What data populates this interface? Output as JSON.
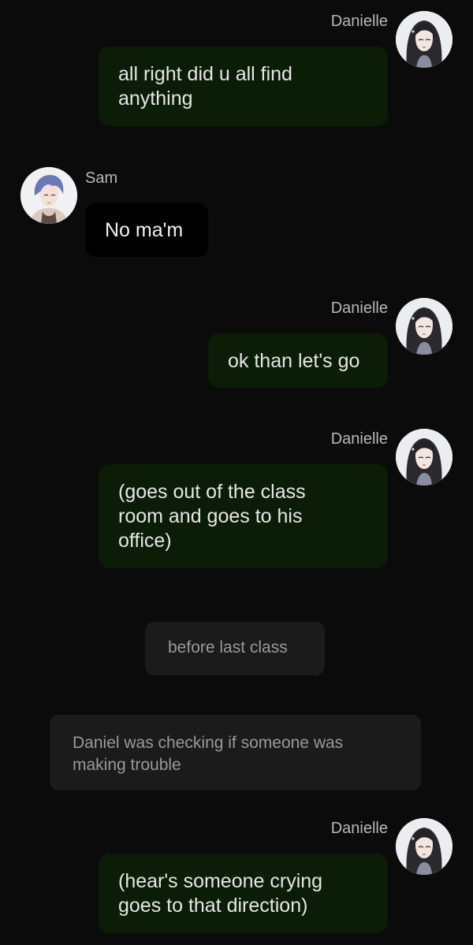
{
  "messages": [
    {
      "sender": "Danielle",
      "side": "right",
      "lines": [
        "all right did u all find",
        "anything"
      ]
    },
    {
      "sender": "Sam",
      "side": "left",
      "lines": [
        "No ma'm"
      ]
    },
    {
      "sender": "Danielle",
      "side": "right",
      "lines": [
        "ok than let's go"
      ]
    },
    {
      "sender": "Danielle",
      "side": "right",
      "lines": [
        "(goes out of the class",
        "room and goes to his",
        "office)"
      ]
    },
    {
      "sender": "Danielle",
      "side": "right",
      "lines": [
        "(hear's someone crying",
        "goes to that direction)"
      ]
    }
  ],
  "system_notes": [
    {
      "lines": [
        "before last class"
      ]
    },
    {
      "lines": [
        "Daniel was checking if someone was",
        "making trouble"
      ]
    }
  ],
  "colors": {
    "background": "#0b0b0b",
    "own_bubble": "#0b1d06",
    "other_bubble": "#000000",
    "system_bubble": "#1b1b1b"
  },
  "icons": {
    "danielle_avatar": "avatar-danielle-icon",
    "sam_avatar": "avatar-sam-icon"
  }
}
